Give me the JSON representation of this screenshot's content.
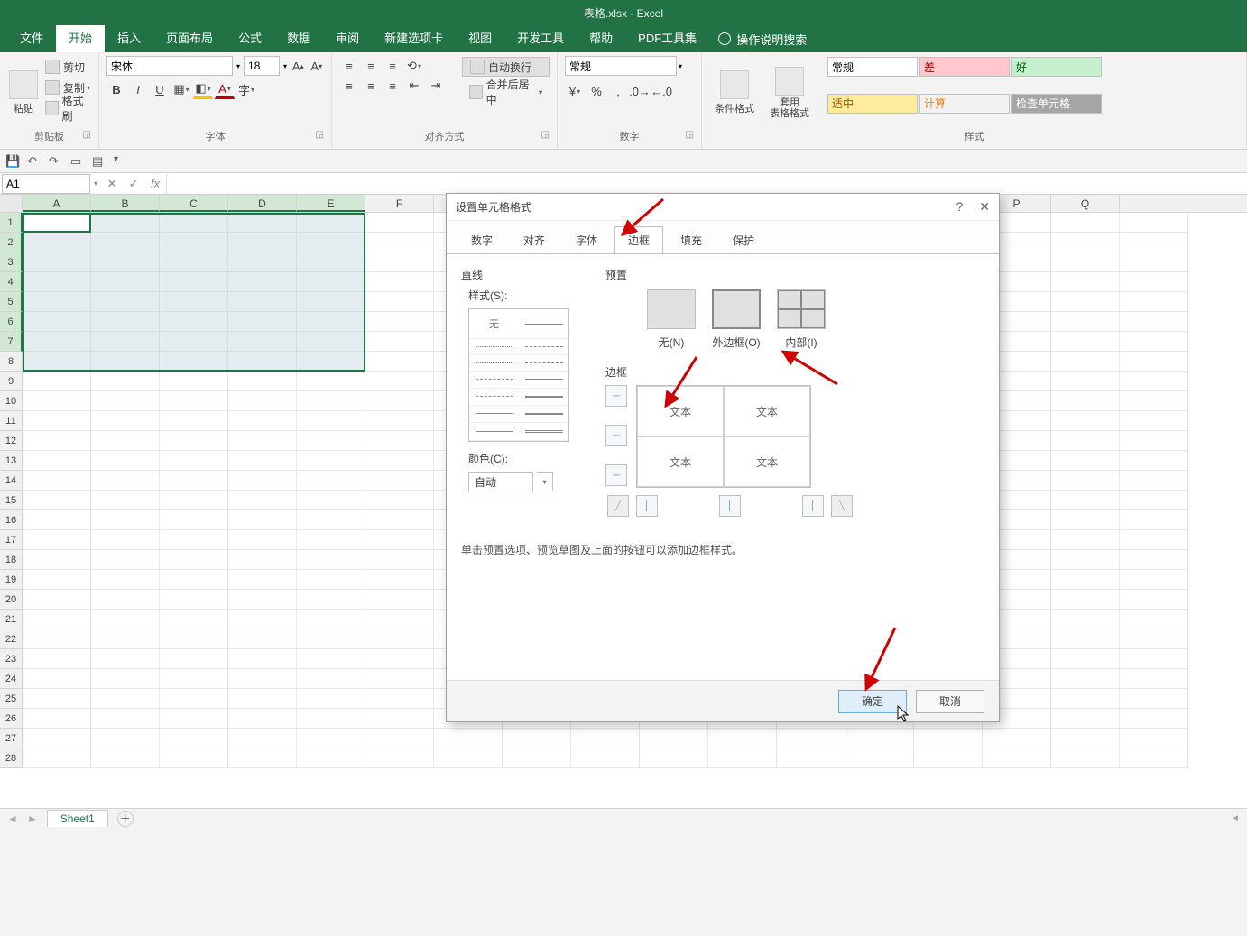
{
  "titlebar": {
    "filename": "表格.xlsx",
    "app": "Excel"
  },
  "tabs": [
    "文件",
    "开始",
    "插入",
    "页面布局",
    "公式",
    "数据",
    "审阅",
    "新建选项卡",
    "视图",
    "开发工具",
    "帮助",
    "PDF工具集"
  ],
  "tab_active": "开始",
  "tellme": "操作说明搜索",
  "ribbon": {
    "clipboard": {
      "paste": "粘贴",
      "cut": "剪切",
      "copy": "复制",
      "painter": "格式刷",
      "label": "剪贴板"
    },
    "font": {
      "name": "宋体",
      "size": "18",
      "label": "字体"
    },
    "align": {
      "wrap": "自动换行",
      "merge": "合并后居中",
      "label": "对齐方式"
    },
    "number": {
      "format": "常规",
      "label": "数字"
    },
    "styles": {
      "cond": "条件格式",
      "table": "套用\n表格格式",
      "label": "样式",
      "boxes": [
        "常规",
        "差",
        "好",
        "适中",
        "计算",
        "检查单元格"
      ]
    }
  },
  "namebox": "A1",
  "columns": [
    "A",
    "B",
    "C",
    "D",
    "E",
    "F",
    "",
    "",
    "",
    "",
    "",
    "",
    "",
    "P",
    "Q"
  ],
  "sheettab": "Sheet1",
  "dialog": {
    "title": "设置单元格格式",
    "tabs": [
      "数字",
      "对齐",
      "字体",
      "边框",
      "填充",
      "保护"
    ],
    "tab_active": "边框",
    "line_label": "直线",
    "style_label": "样式(S):",
    "style_none": "无",
    "color_label": "颜色(C):",
    "color_auto": "自动",
    "preset_label": "预置",
    "presets": {
      "none": "无(N)",
      "outline": "外边框(O)",
      "inside": "内部(I)"
    },
    "border_label": "边框",
    "preview_text": "文本",
    "hint": "单击预置选项、预览草图及上面的按钮可以添加边框样式。",
    "ok": "确定",
    "cancel": "取消"
  }
}
